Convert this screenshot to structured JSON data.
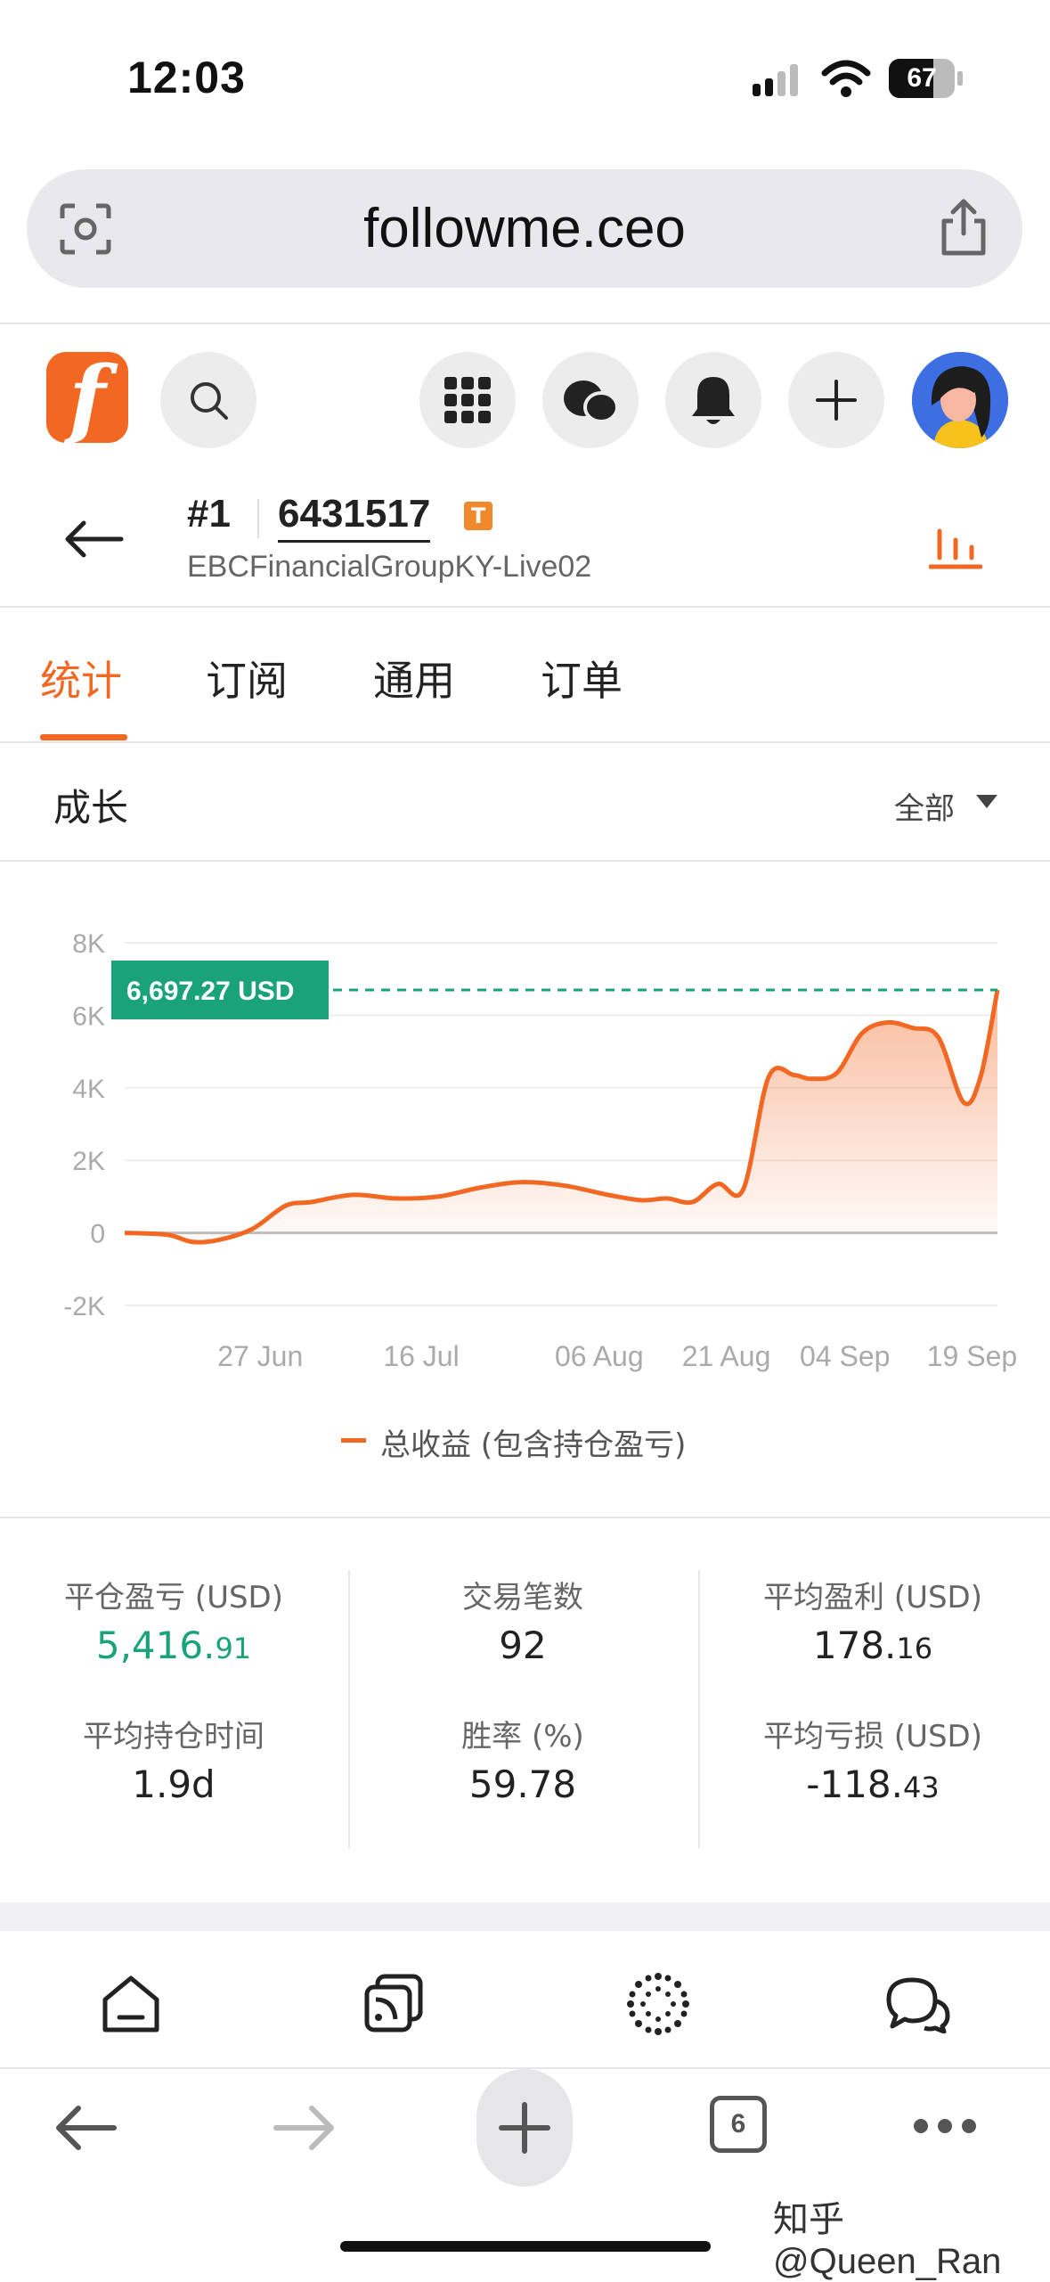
{
  "status_bar": {
    "time": "12:03",
    "battery": "67"
  },
  "browser": {
    "url": "followme.ceo",
    "tab_count": "6"
  },
  "account": {
    "rank": "#1",
    "number": "6431517",
    "badge": "T",
    "server": "EBCFinancialGroupKY-Live02"
  },
  "tabs": [
    {
      "label": "统计"
    },
    {
      "label": "订阅"
    },
    {
      "label": "通用"
    },
    {
      "label": "订单"
    }
  ],
  "growth": {
    "title": "成长",
    "range": "全部",
    "current_label": "6,697.27 USD",
    "legend": "总收益 (包含持仓盈亏)"
  },
  "chart_data": {
    "type": "area",
    "y_ticks": [
      "8K",
      "6K",
      "4K",
      "2K",
      "0",
      "-2K"
    ],
    "x_ticks": [
      "27 Jun",
      "16 Jul",
      "06 Aug",
      "21 Aug",
      "04 Sep",
      "19 Sep"
    ],
    "ylim": [
      -2000,
      8000
    ],
    "current_value": 6697.27,
    "series": [
      {
        "name": "总收益 (包含持仓盈亏)",
        "color": "#f26722",
        "x": [
          "2024-06-11",
          "2024-06-16",
          "2024-06-19",
          "2024-06-22",
          "2024-06-26",
          "2024-06-30",
          "2024-07-03",
          "2024-07-08",
          "2024-07-13",
          "2024-07-18",
          "2024-07-23",
          "2024-07-28",
          "2024-08-02",
          "2024-08-07",
          "2024-08-11",
          "2024-08-14",
          "2024-08-17",
          "2024-08-20",
          "2024-08-23",
          "2024-08-26",
          "2024-08-29",
          "2024-08-31",
          "2024-09-03",
          "2024-09-06",
          "2024-09-09",
          "2024-09-12",
          "2024-09-15",
          "2024-09-18",
          "2024-09-20",
          "2024-09-22"
        ],
        "y": [
          0,
          -50,
          -250,
          -200,
          100,
          750,
          850,
          1050,
          950,
          1000,
          1250,
          1400,
          1300,
          1050,
          900,
          950,
          850,
          1350,
          1200,
          4300,
          4350,
          4250,
          4400,
          5500,
          5800,
          5650,
          5400,
          3600,
          4300,
          6697.27
        ]
      }
    ]
  },
  "stats": [
    {
      "label": "平仓盈亏 (USD)",
      "int": "5,416.",
      "dec": "91",
      "color": "#1aa37a"
    },
    {
      "label": "交易笔数",
      "int": "92",
      "dec": ""
    },
    {
      "label": "平均盈利 (USD)",
      "int": "178.",
      "dec": "16"
    },
    {
      "label": "平均持仓时间",
      "int": "1.9d",
      "dec": ""
    },
    {
      "label": "胜率 (%)",
      "int": "59.78",
      "dec": ""
    },
    {
      "label": "平均亏损 (USD)",
      "int": "-118.",
      "dec": "43"
    }
  ],
  "watermark": "知乎 @Queen_Ran"
}
